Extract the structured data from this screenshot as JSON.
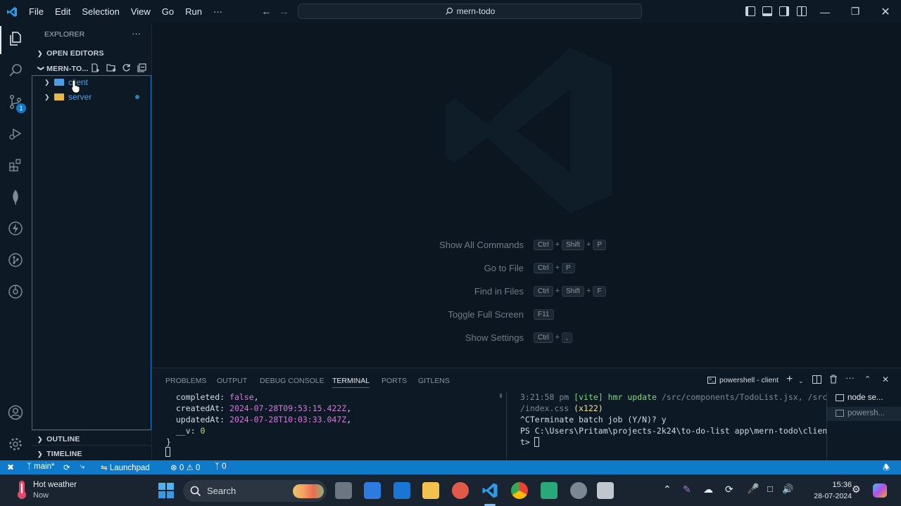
{
  "titlebar": {
    "menu": [
      "File",
      "Edit",
      "Selection",
      "View",
      "Go",
      "Run",
      "···"
    ],
    "command_center": "mern-todo"
  },
  "activity": {
    "scm_badge": "1"
  },
  "sidebar": {
    "title": "EXPLORER",
    "more": "···",
    "open_editors": "OPEN EDITORS",
    "workspace": "MERN-TO...",
    "tree": [
      {
        "label": "client"
      },
      {
        "label": "server"
      }
    ],
    "outline": "OUTLINE",
    "timeline": "TIMELINE"
  },
  "editor": {
    "shortcuts": [
      {
        "label": "Show All Commands",
        "keys": [
          "Ctrl",
          "Shift",
          "P"
        ]
      },
      {
        "label": "Go to File",
        "keys": [
          "Ctrl",
          "P"
        ]
      },
      {
        "label": "Find in Files",
        "keys": [
          "Ctrl",
          "Shift",
          "F"
        ]
      },
      {
        "label": "Toggle Full Screen",
        "keys": [
          "F11"
        ]
      },
      {
        "label": "Show Settings",
        "keys": [
          "Ctrl",
          ","
        ]
      }
    ]
  },
  "panel": {
    "tabs": [
      "PROBLEMS",
      "OUTPUT",
      "DEBUG CONSOLE",
      "TERMINAL",
      "PORTS",
      "GITLENS"
    ],
    "active_tab": "TERMINAL",
    "terminal_name": "powershell - client",
    "left_terminal": {
      "l1_key": "  completed: ",
      "l1_val": "false",
      "l1_end": ",",
      "l2_key": "  createdAt: ",
      "l2_val": "2024-07-28T09:53:15.422Z",
      "l2_end": ",",
      "l3_key": "  updatedAt: ",
      "l3_val": "2024-07-28T10:03:33.047Z",
      "l3_end": ",",
      "l4_key": "  __v: ",
      "l4_val": "0",
      "l5": "}"
    },
    "right_terminal": {
      "r1_time": "3:21:58 pm ",
      "r1_vite": "[vite]",
      "r1_hmr": " hmr update ",
      "r1_path": "/src/components/TodoList.jsx, /src",
      "r2_path": "/index.css",
      "r2_count": " (x122)",
      "r3": "^CTerminate batch job (Y/N)? y",
      "r4": "PS C:\\Users\\Pritam\\projects-2k24\\to-do-list app\\mern-todo\\clien",
      "r5": "t>"
    },
    "terminal_list": [
      "node se...",
      "powersh..."
    ]
  },
  "statusbar": {
    "branch": "main*",
    "launchpad": "Launchpad",
    "errors": "0",
    "warnings": "0",
    "ports": "0"
  },
  "taskbar": {
    "weather_title": "Hot weather",
    "weather_sub": "Now",
    "search": "Search",
    "time": "15:36",
    "date": "28-07-2024"
  },
  "colors": {
    "accent": "#0e7ac9",
    "folder_yellow": "#e8b84a",
    "folder_blue": "#4b9de4"
  }
}
